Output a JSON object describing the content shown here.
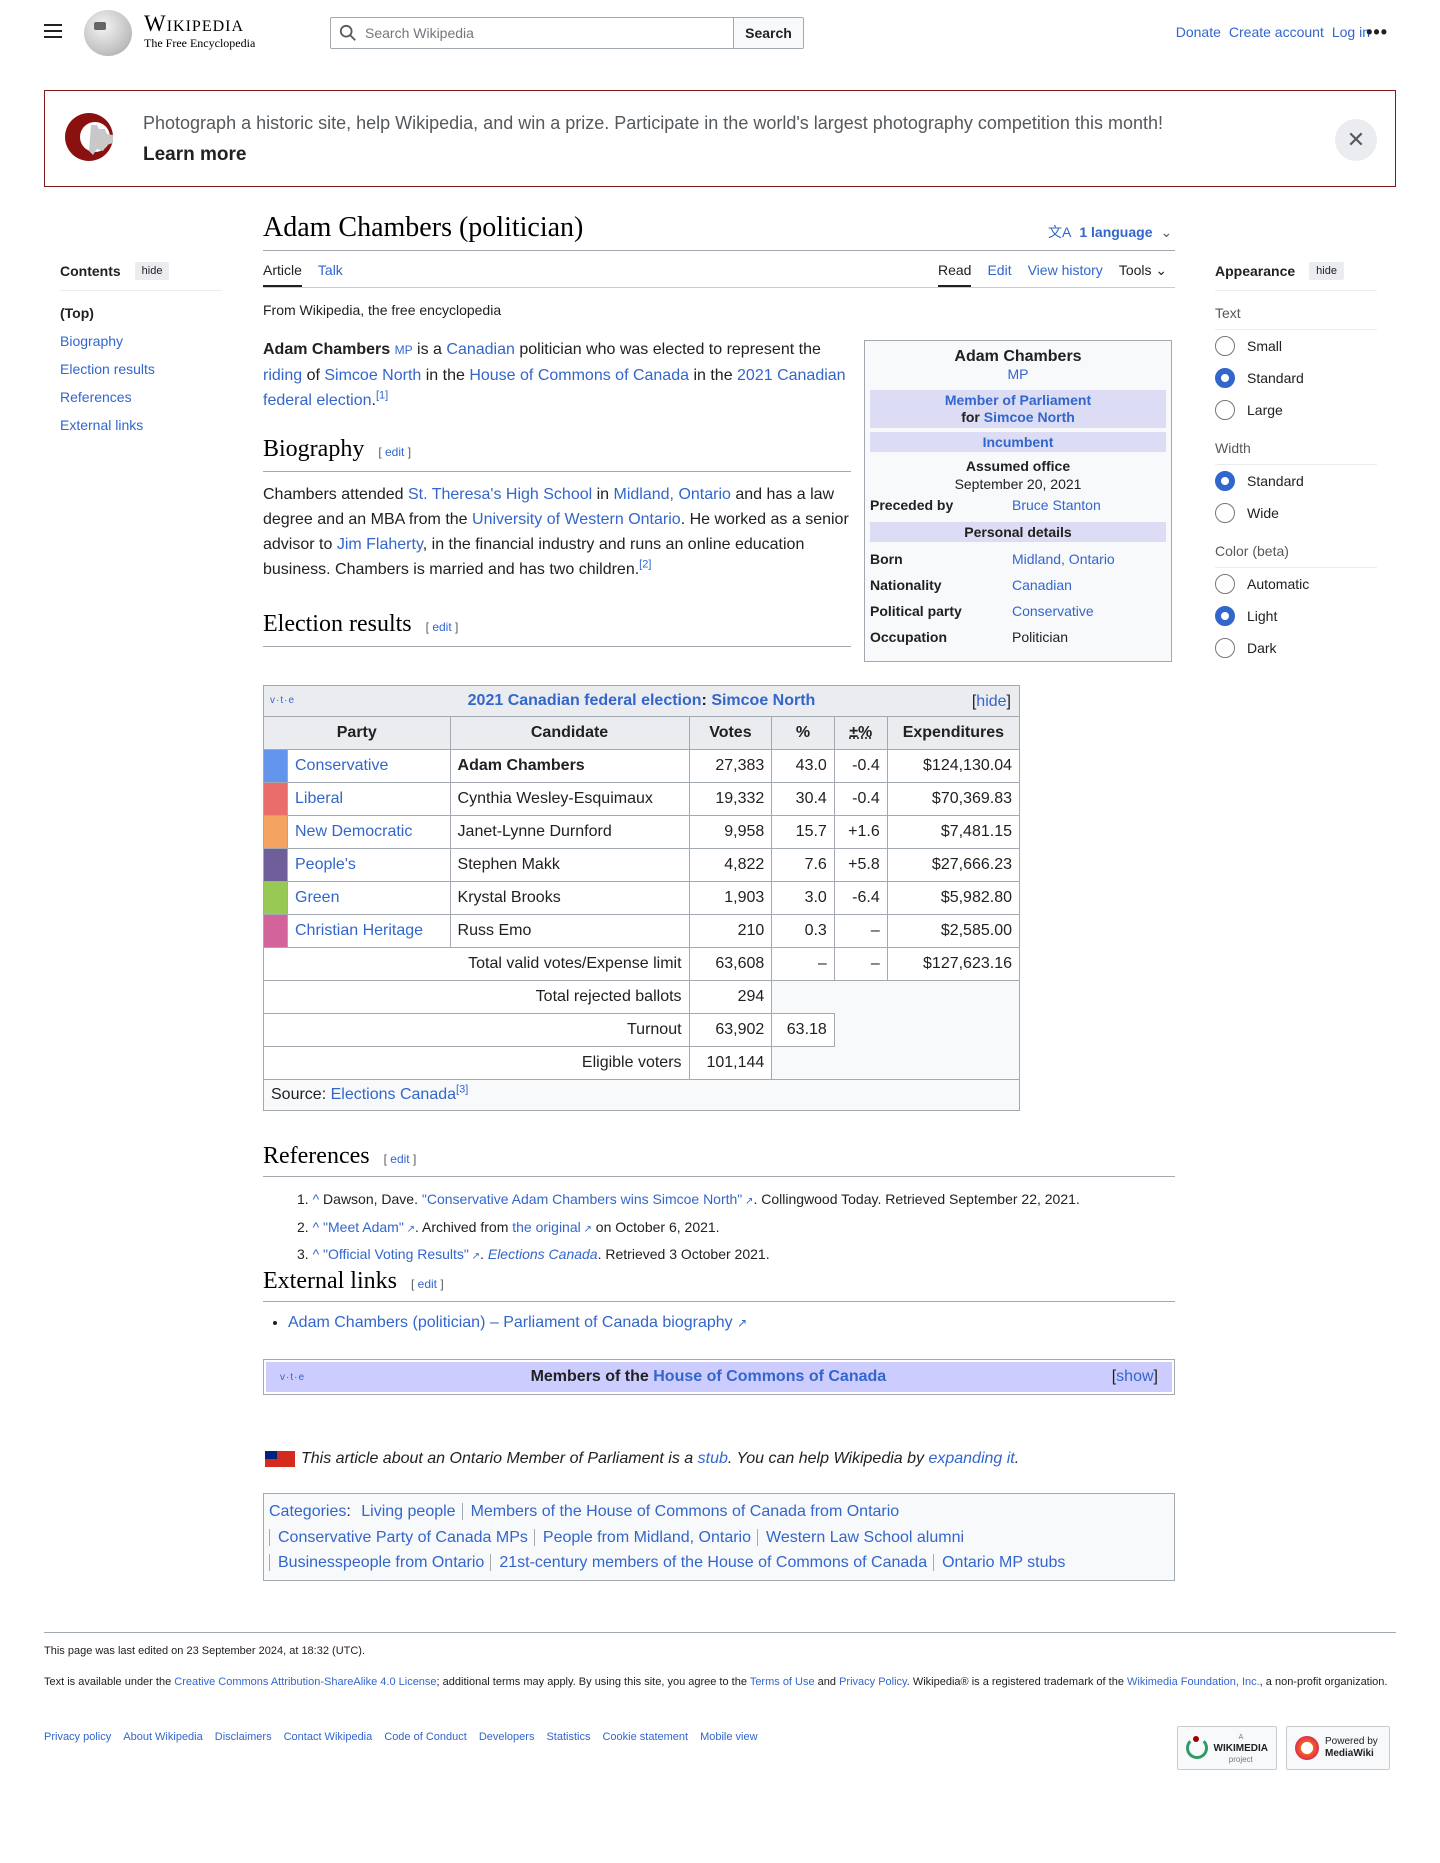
{
  "header": {
    "logo_title": "Wikipedia",
    "logo_tagline": "The Free Encyclopedia",
    "search_placeholder": "Search Wikipedia",
    "search_button": "Search",
    "links": [
      "Donate",
      "Create account",
      "Log in"
    ],
    "more_icon": "ellipsis-icon"
  },
  "banner": {
    "message": "Photograph a historic site, help Wikipedia, and win a prize. Participate in the world's largest photography competition this month!",
    "cta": "Learn more",
    "brand_color": "#7c1a1a"
  },
  "page": {
    "title": "Adam Chambers (politician)",
    "language_button": "1 language",
    "tabs_left": [
      "Article",
      "Talk"
    ],
    "tabs_right": [
      "Read",
      "Edit",
      "View history",
      "Tools"
    ],
    "from": "From Wikipedia, the free encyclopedia"
  },
  "toc": {
    "heading": "Contents",
    "hide": "hide",
    "items": [
      "(Top)",
      "Biography",
      "Election results",
      "References",
      "External links"
    ]
  },
  "appearance": {
    "heading": "Appearance",
    "hide": "hide",
    "text_label": "Text",
    "text_options": [
      {
        "label": "Small",
        "selected": false
      },
      {
        "label": "Standard",
        "selected": true
      },
      {
        "label": "Large",
        "selected": false
      }
    ],
    "width_label": "Width",
    "width_options": [
      {
        "label": "Standard",
        "selected": true
      },
      {
        "label": "Wide",
        "selected": false
      }
    ],
    "color_label": "Color (beta)",
    "color_options": [
      {
        "label": "Automatic",
        "selected": false
      },
      {
        "label": "Light",
        "selected": true
      },
      {
        "label": "Dark",
        "selected": false
      }
    ]
  },
  "intro": {
    "name": "Adam Chambers",
    "mp": "MP",
    "t1": " is a ",
    "canadian": "Canadian",
    "t2": " politician who was elected to represent the ",
    "riding": "riding",
    "t3": " of ",
    "simcoe": "Simcoe North",
    "t4": " in the ",
    "hoc": "House of Commons of Canada",
    "t5": " in the ",
    "election": "2021 Canadian federal election",
    "t6": ".",
    "ref": "[1]"
  },
  "biography": {
    "heading": "Biography",
    "edit": "edit",
    "t1": "Chambers attended ",
    "school": "St. Theresa's High School",
    "t2": " in ",
    "midland": "Midland, Ontario",
    "t3": " and has a law degree and an MBA from the ",
    "uwo": "University of Western Ontario",
    "t4": ". He worked as a senior advisor to ",
    "flaherty": "Jim Flaherty",
    "t5": ", in the financial industry and runs an online education business. Chambers is married and has two children.",
    "ref": "[2]"
  },
  "infobox": {
    "name": "Adam Chambers",
    "postnom": "MP",
    "office": "Member of Parliament",
    "for": "for",
    "riding": "Simcoe North",
    "status": "Incumbent",
    "assumed_label": "Assumed office",
    "assumed_date": "September 20, 2021",
    "preceded_label": "Preceded by",
    "preceded_value": "Bruce Stanton",
    "personal_header": "Personal details",
    "rows": [
      {
        "k": "Born",
        "v": "Midland, Ontario",
        "link": true
      },
      {
        "k": "Nationality",
        "v": "Canadian",
        "link": true
      },
      {
        "k": "Political party",
        "v": "Conservative",
        "link": true
      },
      {
        "k": "Occupation",
        "v": "Politician",
        "link": false
      }
    ]
  },
  "election": {
    "heading": "Election results",
    "edit": "edit",
    "vte": "v·t·e",
    "caption_a": "2021 Canadian federal election",
    "caption_sep": ": ",
    "caption_b": "Simcoe North",
    "hide": "hide",
    "columns": [
      "Party",
      "Candidate",
      "Votes",
      "%",
      "±%",
      "Expenditures"
    ],
    "rows": [
      {
        "party": "Conservative",
        "color": "#6495ed",
        "candidate": "Adam Chambers",
        "votes": "27,383",
        "pct": "43.0",
        "change": "-0.4",
        "exp": "$124,130.04",
        "winner": true
      },
      {
        "party": "Liberal",
        "color": "#ea6d6a",
        "candidate": "Cynthia Wesley-Esquimaux",
        "votes": "19,332",
        "pct": "30.4",
        "change": "-0.4",
        "exp": "$70,369.83",
        "winner": false
      },
      {
        "party": "New Democratic",
        "color": "#f4a460",
        "candidate": "Janet-Lynne Durnford",
        "votes": "9,958",
        "pct": "15.7",
        "change": "+1.6",
        "exp": "$7,481.15",
        "winner": false
      },
      {
        "party": "People's",
        "color": "#6f5d9a",
        "candidate": "Stephen Makk",
        "votes": "4,822",
        "pct": "7.6",
        "change": "+5.8",
        "exp": "$27,666.23",
        "winner": false
      },
      {
        "party": "Green",
        "color": "#99c955",
        "candidate": "Krystal Brooks",
        "votes": "1,903",
        "pct": "3.0",
        "change": "-6.4",
        "exp": "$5,982.80",
        "winner": false
      },
      {
        "party": "Christian Heritage",
        "color": "#d3649b",
        "candidate": "Russ Emo",
        "votes": "210",
        "pct": "0.3",
        "change": "–",
        "exp": "$2,585.00",
        "winner": false
      }
    ],
    "totals": {
      "valid_label": "Total valid votes/Expense limit",
      "valid_votes": "63,608",
      "valid_pct": "–",
      "valid_change": "–",
      "valid_exp": "$127,623.16",
      "rejected_label": "Total rejected ballots",
      "rejected": "294",
      "turnout_label": "Turnout",
      "turnout": "63,902",
      "turnout_pct": "63.18",
      "eligible_label": "Eligible voters",
      "eligible": "101,144"
    },
    "source_label": "Source: ",
    "source_link": "Elections Canada",
    "source_ref": "[3]"
  },
  "references": {
    "heading": "References",
    "edit": "edit",
    "items": [
      {
        "n": "1.",
        "pre": "Dawson, Dave. ",
        "link": "\"Conservative Adam Chambers wins Simcoe North\"",
        "post": ". Collingwood Today. Retrieved September 22, 2021."
      },
      {
        "n": "2.",
        "pre": "",
        "link": "\"Meet Adam\"",
        "post": ". Archived from ",
        "link2": "the original",
        "post2": " on October 6, 2021."
      },
      {
        "n": "3.",
        "pre": "",
        "link": "\"Official Voting Results\"",
        "post": ". ",
        "italic": "Elections Canada",
        "post2": ". Retrieved 3 October 2021."
      }
    ]
  },
  "external": {
    "heading": "External links",
    "edit": "edit",
    "items": [
      "Adam Chambers (politician) – Parliament of Canada biography"
    ]
  },
  "navbox": {
    "vte": "v·t·e",
    "title_pre": "Members of the ",
    "title_link": "House of Commons of Canada",
    "show": "show"
  },
  "stub": {
    "t1": "This article about an Ontario Member of Parliament is a ",
    "stub": "stub",
    "t2": ". You can help Wikipedia by ",
    "expand": "expanding it",
    "t3": "."
  },
  "categories": {
    "label": "Categories",
    "items": [
      "Living people",
      "Members of the House of Commons of Canada from Ontario",
      "Conservative Party of Canada MPs",
      "People from Midland, Ontario",
      "Western Law School alumni",
      "Businesspeople from Ontario",
      "21st-century members of the House of Commons of Canada",
      "Ontario MP stubs"
    ]
  },
  "footer": {
    "last_edited": "This page was last edited on 23 September 2024, at 18:32 (UTC).",
    "lic_t1": "Text is available under the ",
    "lic_link": "Creative Commons Attribution-ShareAlike 4.0 License",
    "lic_t2": "; additional terms may apply. By using this site, you agree to the ",
    "terms": "Terms of Use",
    "and": " and ",
    "privacy": "Privacy Policy",
    "lic_t3": ". Wikipedia® is a registered trademark of the ",
    "wmf": "Wikimedia Foundation, Inc.",
    "lic_t4": ", a non-profit organization.",
    "links": [
      "Privacy policy",
      "About Wikipedia",
      "Disclaimers",
      "Contact Wikipedia",
      "Code of Conduct",
      "Developers",
      "Statistics",
      "Cookie statement",
      "Mobile view"
    ],
    "badge1_top": "A",
    "badge1": "WIKIMEDIA",
    "badge1_sub": "project",
    "badge2_a": "Powered by",
    "badge2_b": "MediaWiki"
  }
}
